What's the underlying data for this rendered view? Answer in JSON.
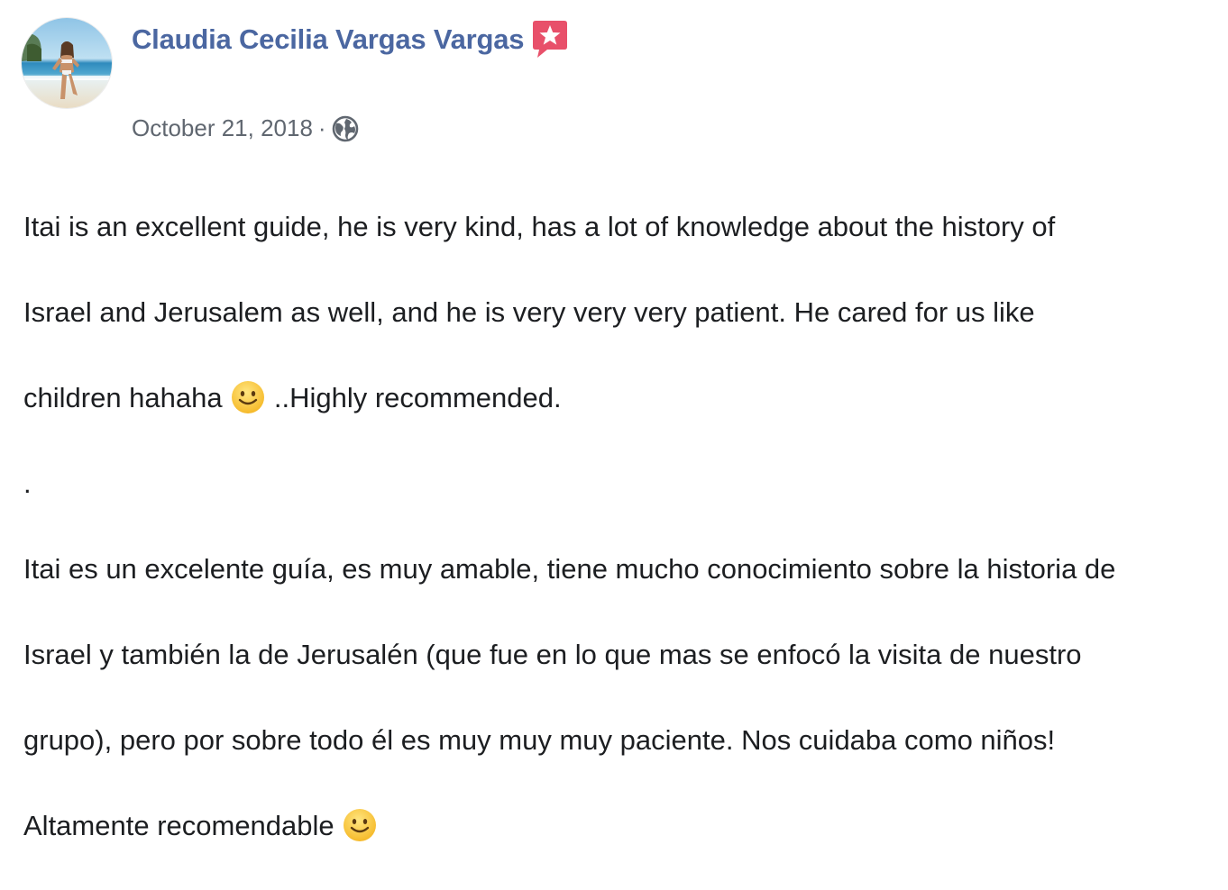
{
  "post": {
    "author": {
      "name": "Claudia Cecilia Vargas Vargas",
      "avatar_icon": "profile-photo",
      "badge_icon": "recommends-star-icon",
      "link_color": "#4b67a1"
    },
    "meta": {
      "date": "October 21, 2018",
      "separator": "·",
      "privacy_icon": "globe-icon"
    },
    "body": {
      "l1": "Itai is an excellent guide, he is very kind, has a lot of knowledge about the history of",
      "l2": "Israel and Jerusalem as well, and he is very very very patient. He cared for us like",
      "l3a": "children hahaha ",
      "l3b": " ..Highly recommended.",
      "l4": ".",
      "l5": "Itai es un excelente guía, es muy amable, tiene mucho conocimiento sobre la historia de",
      "l6": "Israel y también la de Jerusalén (que fue en lo que mas se enfocó la visita de nuestro",
      "l7": "grupo), pero por sobre todo él es muy muy muy paciente. Nos cuidaba como niños!",
      "l8": "Altamente recomendable ",
      "emoji_icon": "slightly-smiling-face-emoji"
    }
  }
}
